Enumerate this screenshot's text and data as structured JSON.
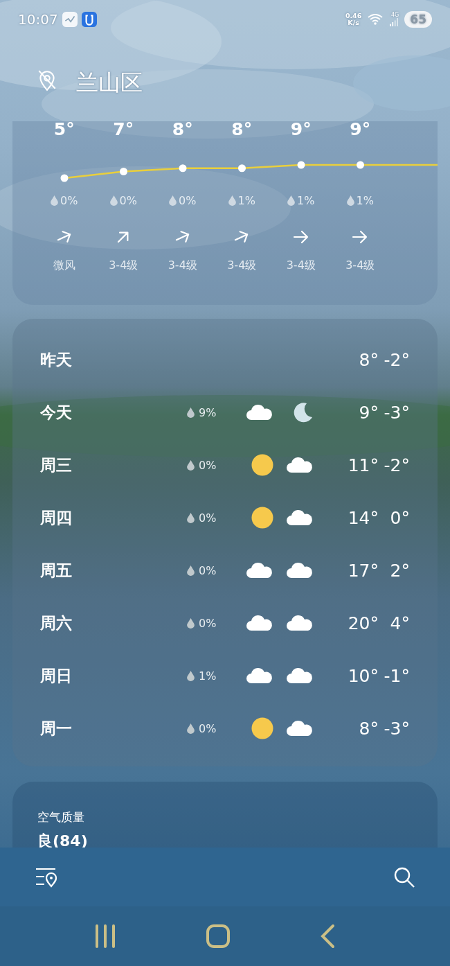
{
  "status_bar": {
    "time": "10:07",
    "net_speed": "0.46",
    "net_unit": "K/s",
    "network": "4G",
    "battery": "65"
  },
  "location": {
    "title": "兰山区"
  },
  "hourly": [
    {
      "temp": "5°",
      "precip": "0%",
      "arrow": {
        "kind": "ene"
      },
      "wind": "微风"
    },
    {
      "temp": "7°",
      "precip": "0%",
      "arrow": {
        "kind": "ne"
      },
      "wind": "3-4级"
    },
    {
      "temp": "8°",
      "precip": "0%",
      "arrow": {
        "kind": "ene"
      },
      "wind": "3-4级"
    },
    {
      "temp": "8°",
      "precip": "1%",
      "arrow": {
        "kind": "ene"
      },
      "wind": "3-4级"
    },
    {
      "temp": "9°",
      "precip": "1%",
      "arrow": {
        "kind": "e"
      },
      "wind": "3-4级"
    },
    {
      "temp": "9°",
      "precip": "1%",
      "arrow": {
        "kind": "e"
      },
      "wind": "3-4级"
    }
  ],
  "daily": [
    {
      "day": "昨天",
      "high": "8°",
      "low": "-2°"
    },
    {
      "day": "今天",
      "precip": "9%",
      "icons": [
        {
          "kind": "cloud"
        },
        {
          "kind": "moon"
        }
      ],
      "high": "9°",
      "low": "-3°"
    },
    {
      "day": "周三",
      "precip": "0%",
      "icons": [
        {
          "kind": "sun"
        },
        {
          "kind": "cloud"
        }
      ],
      "high": "11°",
      "low": "-2°"
    },
    {
      "day": "周四",
      "precip": "0%",
      "icons": [
        {
          "kind": "sun"
        },
        {
          "kind": "cloud"
        }
      ],
      "high": "14°",
      "low": "0°"
    },
    {
      "day": "周五",
      "precip": "0%",
      "icons": [
        {
          "kind": "cloud"
        },
        {
          "kind": "cloud"
        }
      ],
      "high": "17°",
      "low": "2°"
    },
    {
      "day": "周六",
      "precip": "0%",
      "icons": [
        {
          "kind": "cloud"
        },
        {
          "kind": "cloud"
        }
      ],
      "high": "20°",
      "low": "4°"
    },
    {
      "day": "周日",
      "precip": "1%",
      "icons": [
        {
          "kind": "cloud"
        },
        {
          "kind": "cloud"
        }
      ],
      "high": "10°",
      "low": "-1°"
    },
    {
      "day": "周一",
      "precip": "0%",
      "icons": [
        {
          "kind": "sun"
        },
        {
          "kind": "cloud"
        }
      ],
      "high": "8°",
      "low": "-3°"
    }
  ],
  "air_quality": {
    "label": "空气质量",
    "value": "良(84)"
  }
}
